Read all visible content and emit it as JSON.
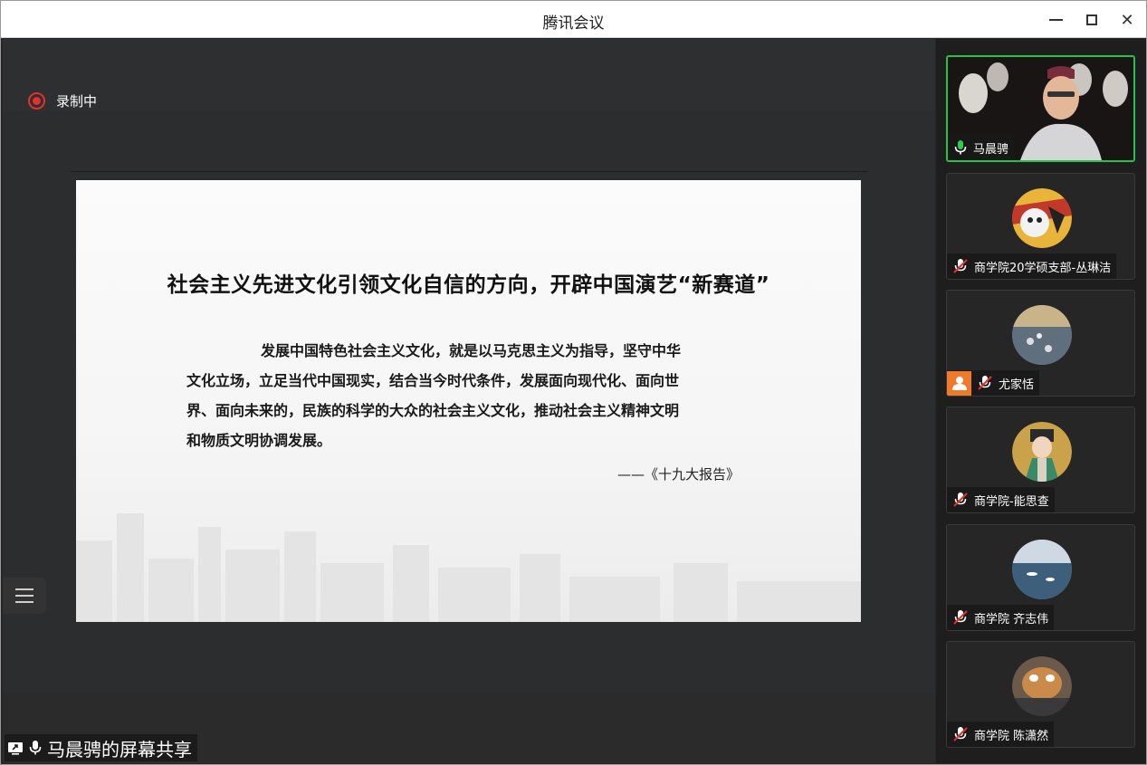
{
  "window": {
    "title": "腾讯会议",
    "minimize_label": "",
    "maximize_label": "",
    "close_label": "✕"
  },
  "stage": {
    "recording_label": "录制中",
    "share_label": "马晨骋的屏幕共享"
  },
  "slide": {
    "title": "社会主义先进文化引领文化自信的方向，开辟中国演艺“新赛道”",
    "body_lines": [
      "发展中国特色社会主义文化，就是以马克思主义为指导，坚守中华",
      "文化立场，立足当代中国现实，结合当今时代条件，发展面向现代化、面向世",
      "界、面向未来的，民族的科学的大众的社会主义文化，推动社会主义精神文明",
      "和物质文明协调发展。"
    ],
    "source": "——《十九大报告》"
  },
  "participants": [
    {
      "name": "马晨骋",
      "mic": "on",
      "video": true
    },
    {
      "name": "商学院20学硕支部-丛琳洁",
      "mic": "muted",
      "video": false
    },
    {
      "name": "尤家恬",
      "mic": "muted",
      "video": false,
      "host_badge": true
    },
    {
      "name": "商学院-能思查",
      "mic": "muted",
      "video": false
    },
    {
      "name": "商学院 齐志伟",
      "mic": "muted",
      "video": false
    },
    {
      "name": "商学院 陈潇然",
      "mic": "muted",
      "video": false
    }
  ],
  "colors": {
    "recording": "#e0322f",
    "active_speaker": "#27c24c",
    "host_badge": "#f07a2b"
  }
}
